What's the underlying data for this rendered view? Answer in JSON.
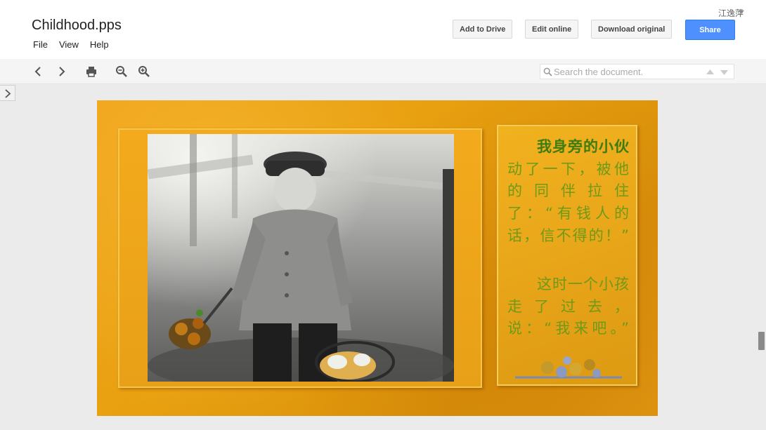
{
  "header": {
    "doc_title": "Childhood.pps",
    "menu": [
      "File",
      "View",
      "Help"
    ],
    "user_name": "江逸萍",
    "buttons": {
      "add_to_drive": "Add to Drive",
      "edit_online": "Edit online",
      "download_original": "Download original",
      "share": "Share"
    },
    "share_color": "#4d90fe"
  },
  "toolbar": {
    "icons": [
      "previous-page-icon",
      "next-page-icon",
      "print-icon",
      "zoom-out-icon",
      "zoom-in-icon"
    ],
    "search_placeholder": "Search the document."
  },
  "slide": {
    "background_color": "#e8a010",
    "photo": "black-and-white photo of a young boy in a cap and coat holding flowers and a basket",
    "text_para1_bold": "我身旁的小伙",
    "text_para1_rest": "动了一下，被他的同伴拉住了：“有钱人的话，信不得的！”",
    "text_para2": "这时一个小孩走了过去，说：“我来吧。”",
    "text_color": "#6e9a18"
  }
}
